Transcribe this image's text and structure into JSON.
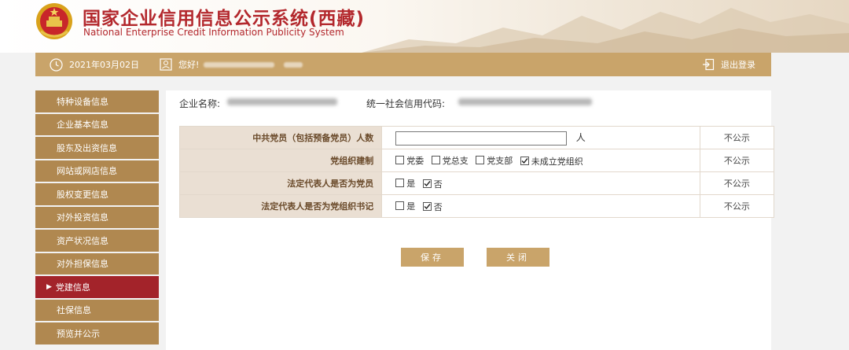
{
  "header": {
    "title_cn": "国家企业信用信息公示系统(西藏)",
    "title_en": "National Enterprise Credit Information Publicity System",
    "emblem_icon": "national-emblem-icon"
  },
  "topbar": {
    "date": "2021年03月02日",
    "greeting": "您好!",
    "logout": "退出登录"
  },
  "sidebar": {
    "items": [
      {
        "label": "特种设备信息",
        "active": false
      },
      {
        "label": "企业基本信息",
        "active": false
      },
      {
        "label": "股东及出资信息",
        "active": false
      },
      {
        "label": "网站或网店信息",
        "active": false
      },
      {
        "label": "股权变更信息",
        "active": false
      },
      {
        "label": "对外投资信息",
        "active": false
      },
      {
        "label": "资产状况信息",
        "active": false
      },
      {
        "label": "对外担保信息",
        "active": false
      },
      {
        "label": "党建信息",
        "active": true
      },
      {
        "label": "社保信息",
        "active": false
      },
      {
        "label": "预览并公示",
        "active": false
      }
    ],
    "active_marker": "▶"
  },
  "main": {
    "company_name_label": "企业名称:",
    "credit_code_label": "统一社会信用代码:",
    "rows": [
      {
        "label": "中共党员（包括预备党员）人数",
        "input_value": "",
        "unit": "人",
        "status": "不公示"
      },
      {
        "label": "党组织建制",
        "options": [
          {
            "label": "党委",
            "checked": false
          },
          {
            "label": "党总支",
            "checked": false
          },
          {
            "label": "党支部",
            "checked": false
          },
          {
            "label": "未成立党组织",
            "checked": true
          }
        ],
        "status": "不公示"
      },
      {
        "label": "法定代表人是否为党员",
        "options": [
          {
            "label": "是",
            "checked": false
          },
          {
            "label": "否",
            "checked": true
          }
        ],
        "status": "不公示"
      },
      {
        "label": "法定代表人是否为党组织书记",
        "options": [
          {
            "label": "是",
            "checked": false
          },
          {
            "label": "否",
            "checked": true
          }
        ],
        "status": "不公示"
      }
    ],
    "save_label": "保存",
    "close_label": "关闭"
  },
  "colors": {
    "brand_red": "#b3282d",
    "gold": "#c9a46a",
    "sidebar_brown": "#b08850",
    "active_red": "#a3232a",
    "label_bg": "#eadfd3"
  }
}
